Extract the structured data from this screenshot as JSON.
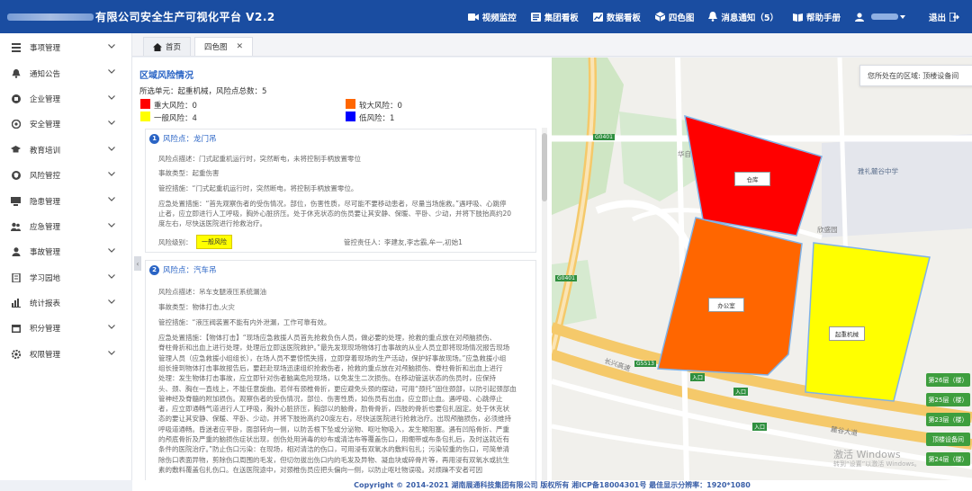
{
  "header": {
    "title": "有限公司安全生产可视化平台  V2.2",
    "nav": [
      {
        "label": "视频监控",
        "icon": "video-camera-icon"
      },
      {
        "label": "集团看板",
        "icon": "board-icon"
      },
      {
        "label": "数据看板",
        "icon": "chart-icon"
      },
      {
        "label": "四色图",
        "icon": "cube-icon"
      },
      {
        "label": "消息通知（5）",
        "icon": "bell-icon"
      },
      {
        "label": "帮助手册",
        "icon": "book-icon"
      }
    ],
    "logout": "退出"
  },
  "sidebar": {
    "items": [
      {
        "label": "事项管理",
        "icon": "list-icon"
      },
      {
        "label": "通知公告",
        "icon": "bell-icon"
      },
      {
        "label": "企业管理",
        "icon": "building-icon"
      },
      {
        "label": "安全管理",
        "icon": "gauge-icon"
      },
      {
        "label": "教育培训",
        "icon": "graduation-cap-icon"
      },
      {
        "label": "风险管控",
        "icon": "shield-icon"
      },
      {
        "label": "隐患管理",
        "icon": "monitor-icon"
      },
      {
        "label": "应急管理",
        "icon": "people-icon"
      },
      {
        "label": "事故管理",
        "icon": "person-icon"
      },
      {
        "label": "学习园地",
        "icon": "book-icon"
      },
      {
        "label": "统计报表",
        "icon": "bar-chart-icon"
      },
      {
        "label": "积分管理",
        "icon": "calendar-icon"
      },
      {
        "label": "权限管理",
        "icon": "settings-icon"
      }
    ]
  },
  "tabs": [
    {
      "label": "首页",
      "icon": "home-icon"
    },
    {
      "label": "四色图",
      "closable": true
    }
  ],
  "panel": {
    "title": "区域风险情况",
    "selection": "所选单元：起重机械，风险点总数：5",
    "legend": [
      {
        "label": "重大风险：0",
        "color": "#ff0000"
      },
      {
        "label": "较大风险：0",
        "color": "#ff6600"
      },
      {
        "label": "一般风险：4",
        "color": "#ffff00"
      },
      {
        "label": "低风险：1",
        "color": "#0000ff"
      }
    ],
    "cards": [
      {
        "num": "1",
        "point": "风险点：龙门吊",
        "desc": "风险点描述：门式起重机运行时，突然断电，未将控制手柄放置零位",
        "type": "事故类型：起重伤害",
        "control": "管控措施：“门式起重机运行时，突然断电，将控制手柄放置零位。",
        "emergency": [
          "应急处置措施：“首先观察伤者的受伤情况，部位，伤害性质，尽可能不要移动患者，尽量当场施救。”遇呼吸、心跳停",
          "止者，应立即进行人工呼吸，胸外心脏挤压。处于休克状态的伤员要让其安静、保暖、平卧、少动，并将下肢抬高约20",
          "度左右，尽快送医院进行抢救治疗。"
        ],
        "level_label": "风险级别：",
        "level": "一般风险",
        "owner": "管控责任人：李建友,李志霸,牟一,初始1"
      },
      {
        "num": "2",
        "point": "风险点：汽车吊",
        "desc": "风险点描述：吊车支腿液压系统漏油",
        "type": "事故类型：物体打击,火灾",
        "control": "管控措施：“液压阀装置不能有内外泄漏，工作可靠有效。",
        "emergency": [
          "应急处置措施：【物体打击】“现场应急救援人员首先抢救负伤人员，做必要的处理，抢救的重点放在对颅脑损伤、",
          "脊柱骨折和出血上进行处理，处理后立即送医院救护。”最先发现现场物体打击事故的从业人员立即将现场情况报告现场",
          "管理人员（应急救援小组组长），在场人员不要惊慌失措，立即穿着现场的生产活动，保护好事故现场。”应急救援小组",
          "组长接到物体打击事故报告后，要赶赴现场迅速组织抢救伤者，抢救的重点放在对颅脑损伤、脊柱骨折和出血上进行",
          "处理：发生物体打击事故，应立即针对伤者脑离危险现场，以免发生二次损伤。在移动管送状态的伤员时，应保持",
          "头、颈、胸在一直线上，不能任意旋曲。若伴有颈椎骨折，更应避免头颈的摆动，可用“颈托”固住颈部，以防引起颈部血",
          "管神经及脊髓的附加损伤。观察伤者的受伤情况，部位、伤害性质，如伤员有出血，应立即止血。遇呼吸、心跳停止",
          "者，应立即通畅气道进行人工呼吸，胸外心脏挤压，胸部以的脑骨，肋骨骨折，四肢的骨折也要包扎固定。处于休克状",
          "态的要让其安静、保暖、平卧、少动，并将下肢抬高约20度左右，尽快送医院进行抢救治疗。出现颅脑损伤，必须维持",
          "呼吸道通畅。昏迷者应平卧，面部转向一侧，以防舌根下坠或分泌物、呕吐物吸入，发生喉阻塞。遇有凹陷骨折、严重",
          "的颅底骨折及严重的脑损伤症状出现，创伤处用消毒的纱布或清洁布等覆盖伤口，用绷带或布条包扎后，及时送就近有",
          "条件的医院治疗。”防止伤口污染：在现场，相对清洁的伤口，可用浸有双氧水的敷料包扎；污染较重的伤口，可简单清",
          "除伤口表面异物，剪除伤口周围的毛发，但切勿拔出伤口内的毛发及异物、凝血块或碎骨片等，再用浸有双氧水或抗生",
          "素的敷料覆盖包扎伤口。在送医院途中，对颈椎伤员应把头偏向一侧，以防止呕吐物误吸。对烦躁不安者可因"
        ]
      }
    ]
  },
  "map": {
    "location": "您所处在的区域: 顶楼设备间",
    "zones": [
      {
        "label": "仓库",
        "color": "#ff0000"
      },
      {
        "label": "办公室",
        "color": "#ff6600"
      },
      {
        "label": "起重机械",
        "color": "#ffff00"
      }
    ],
    "floors": [
      "第26层（楼）",
      "第25层（楼）",
      "第23层（楼）",
      "顶楼设备间",
      "第24层（楼）"
    ],
    "place_labels": [
      "雅礼麓谷中学",
      "欣盛园",
      "长兴高速",
      "华自",
      "麓谷大道"
    ],
    "road_tags": [
      "G0401",
      "G0401",
      "G5513",
      "入口",
      "入口",
      "入口"
    ],
    "watermark": [
      "激活 Windows",
      "转到“设置”以激活 Windows。"
    ]
  },
  "footer": {
    "text": "Copyright © 2014-2021 湖南展通科技集团有限公司 版权所有 湘ICP备18004301号 最佳显示分辨率：1920*1080"
  }
}
